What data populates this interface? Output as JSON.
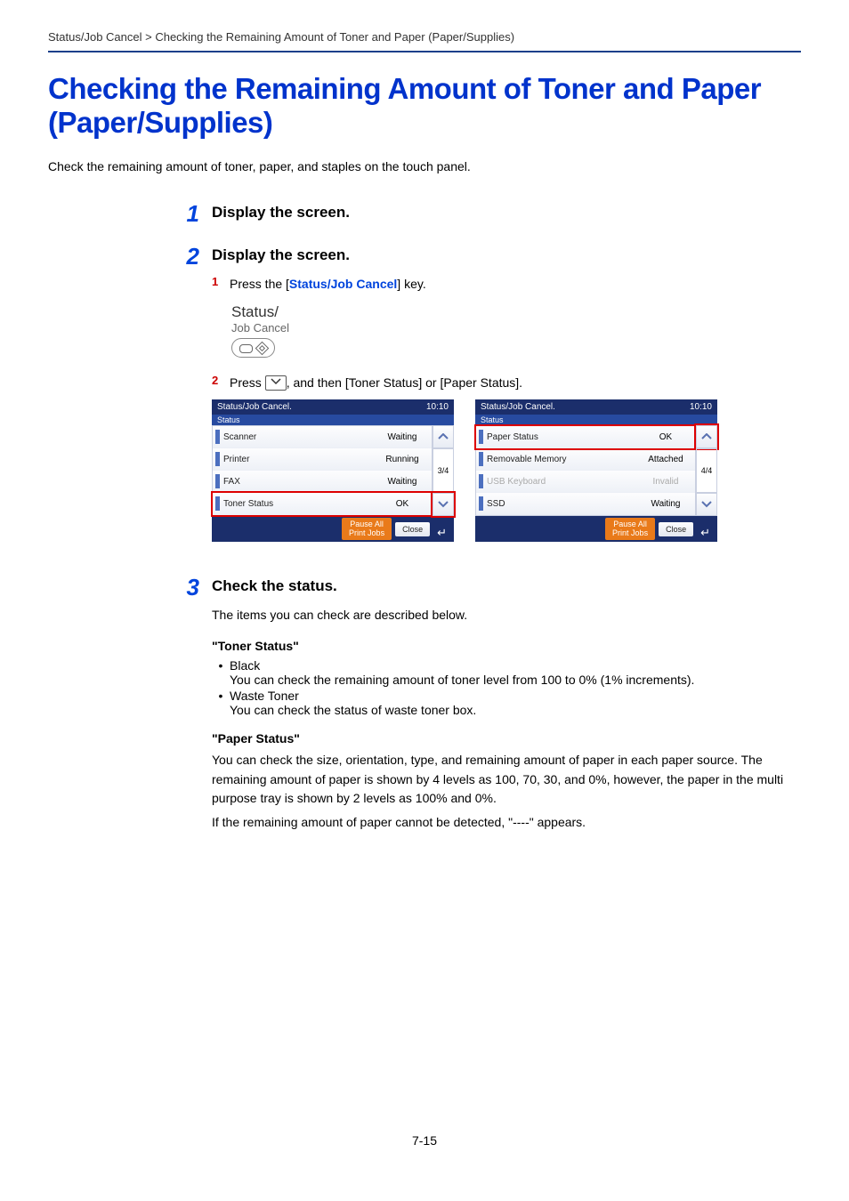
{
  "crumb": "Status/Job Cancel > Checking the Remaining Amount of Toner and Paper (Paper/Supplies)",
  "title": "Checking the Remaining Amount of Toner and Paper (Paper/Supplies)",
  "intro": "Check the remaining amount of toner, paper, and staples on the touch panel.",
  "steps": {
    "s1": {
      "num": "1",
      "head": "Display the screen."
    },
    "s2": {
      "num": "2",
      "head": "Display the screen.",
      "sub1": {
        "n": "1",
        "a": "Press the [",
        "link": "Status/Job Cancel",
        "b": "] key."
      },
      "key": {
        "l1": "Status/",
        "l2": "Job Cancel"
      },
      "sub2": {
        "n": "2",
        "a": "Press ",
        "b": ", and then [Toner Status] or [Paper Status]."
      }
    },
    "s3": {
      "num": "3",
      "head": "Check the status.",
      "line": "The items you can check are described below.",
      "toner_h": "\"Toner Status\"",
      "b1_t": "Black",
      "b1_d": "You can check the remaining amount of toner level from 100 to 0% (1% increments).",
      "b2_t": "Waste Toner",
      "b2_d": "You can check the status of waste toner box.",
      "paper_h": "\"Paper Status\"",
      "p1": "You can check the size, orientation, type, and remaining amount of paper in each paper source. The remaining amount of paper is shown by 4 levels as 100, 70, 30, and 0%, however, the paper in the multi purpose tray is shown by 2 levels as 100% and 0%.",
      "p2": "If the remaining amount of paper cannot be detected, \"----\" appears."
    }
  },
  "panels": {
    "left": {
      "bar_l": "Status/Job Cancel.",
      "bar_r": "10:10",
      "strip": "Status",
      "items": [
        {
          "name": "Scanner",
          "st": "Waiting",
          "sel": false
        },
        {
          "name": "Printer",
          "st": "Running",
          "sel": false
        },
        {
          "name": "FAX",
          "st": "Waiting",
          "sel": false
        },
        {
          "name": "Toner Status",
          "st": "OK",
          "sel": true
        }
      ],
      "page": "3/4",
      "up_sel": false,
      "down_sel": true,
      "pause": "Pause All Print Jobs",
      "close": "Close"
    },
    "right": {
      "bar_l": "Status/Job Cancel.",
      "bar_r": "10:10",
      "strip": "Status",
      "items": [
        {
          "name": "Paper Status",
          "st": "OK",
          "sel": true
        },
        {
          "name": "Removable Memory",
          "st": "Attached",
          "sel": false
        },
        {
          "name": "USB Keyboard",
          "st": "Invalid",
          "sel": false,
          "dis": true
        },
        {
          "name": "SSD",
          "st": "Waiting",
          "sel": false
        }
      ],
      "page": "4/4",
      "up_sel": true,
      "down_sel": false,
      "pause": "Pause All Print Jobs",
      "close": "Close"
    }
  },
  "pagenum": "7-15"
}
